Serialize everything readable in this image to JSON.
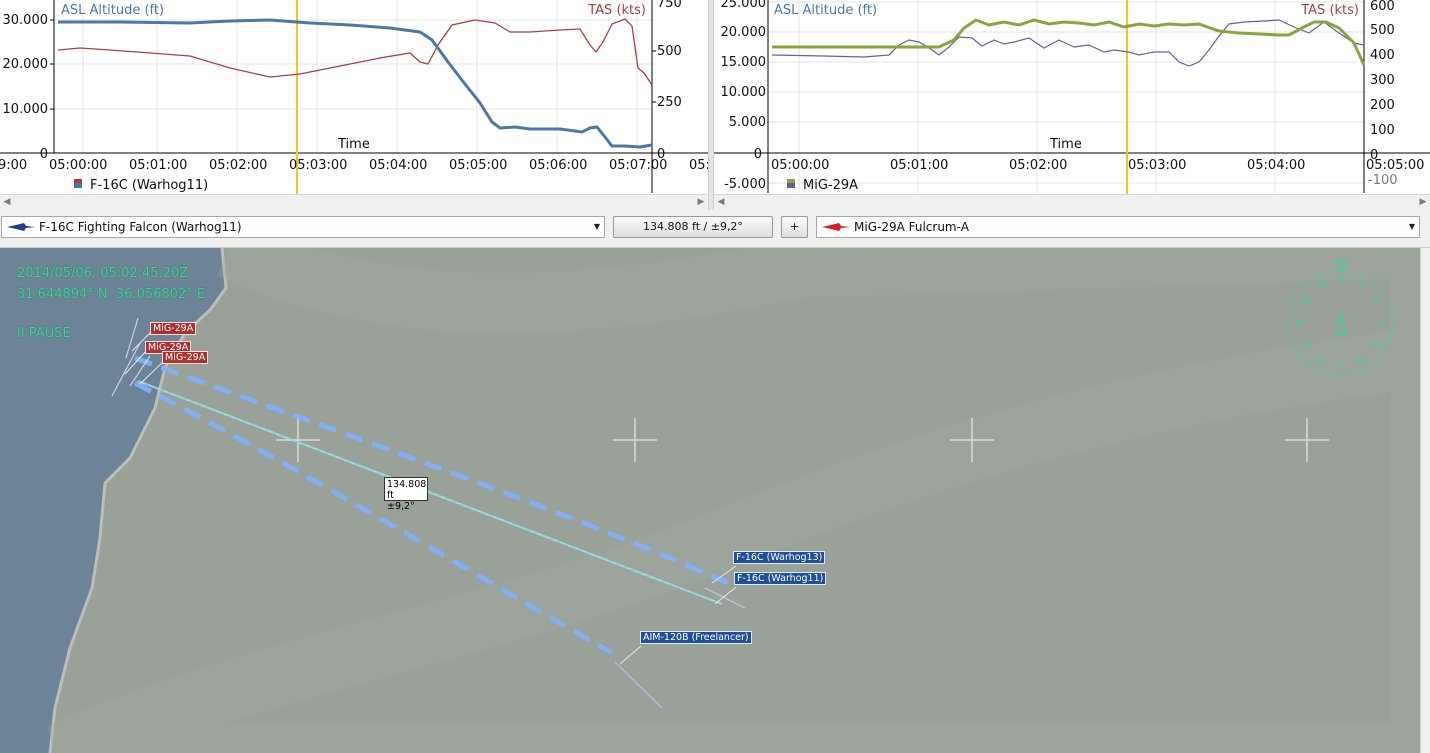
{
  "left_chart": {
    "left_axis_title": "ASL Altitude (ft)",
    "right_axis_title": "TAS (kts)",
    "x_label": "Time",
    "left_ticks": [
      "30.000",
      "20.000",
      "10.000",
      "0"
    ],
    "right_ticks": [
      "750",
      "500",
      "250",
      "0"
    ],
    "time_ticks": [
      "9:00",
      "05:00:00",
      "05:01:00",
      "05:02:00",
      "05:03:00",
      "05:04:00",
      "05:05:00",
      "05:06:00",
      "05:07:00",
      "05:"
    ],
    "legend": "F-16C (Warhog11)",
    "altitude_color": "#4a78a8",
    "speed_color": "#a84040",
    "marker_color": "#f5c518"
  },
  "right_chart": {
    "left_axis_title": "ASL Altitude (ft)",
    "right_axis_title": "TAS (kts)",
    "x_label": "Time",
    "left_ticks": [
      "25.000",
      "20.000",
      "15.000",
      "10.000",
      "5.000",
      "0",
      "-5.000"
    ],
    "right_ticks": [
      "600",
      "500",
      "400",
      "300",
      "200",
      "100",
      "0",
      "-100"
    ],
    "time_ticks": [
      "05:00:00",
      "05:01:00",
      "05:02:00",
      "05:03:00",
      "05:04:00",
      "05:05:00"
    ],
    "legend": "MiG-29A",
    "altitude_color": "#86a83a",
    "speed_color": "#6a5f9e",
    "marker_color": "#f5c518"
  },
  "selectors": {
    "left_aircraft": "F-16C Fighting Falcon (Warhog11)",
    "measurement": "134.808 ft / ±9,2°",
    "add_button": "+",
    "right_aircraft": "MiG-29A Fulcrum-A"
  },
  "map": {
    "timestamp": "2014/05/06, 05:02:45.20Z",
    "coordinates": "31.644894° N  36.056802° E",
    "pause": "II PAUSE",
    "distance_line1": "134.808 ft",
    "distance_line2": "±9,2°",
    "labels": {
      "mig1": "MiG-29A",
      "mig2": "MiG-29A",
      "mig3": "MiG-29A",
      "warhog13": "F-16C (Warhog13)",
      "warhog11": "F-16C (Warhog11)",
      "aim120": "AIM-120B (Freelancer)"
    },
    "compass_labels": [
      "N",
      "3",
      "6",
      "E",
      "12",
      "15",
      "S",
      "21",
      "24",
      "W",
      "30",
      "33"
    ],
    "hud_color": "#3bd39a"
  }
}
